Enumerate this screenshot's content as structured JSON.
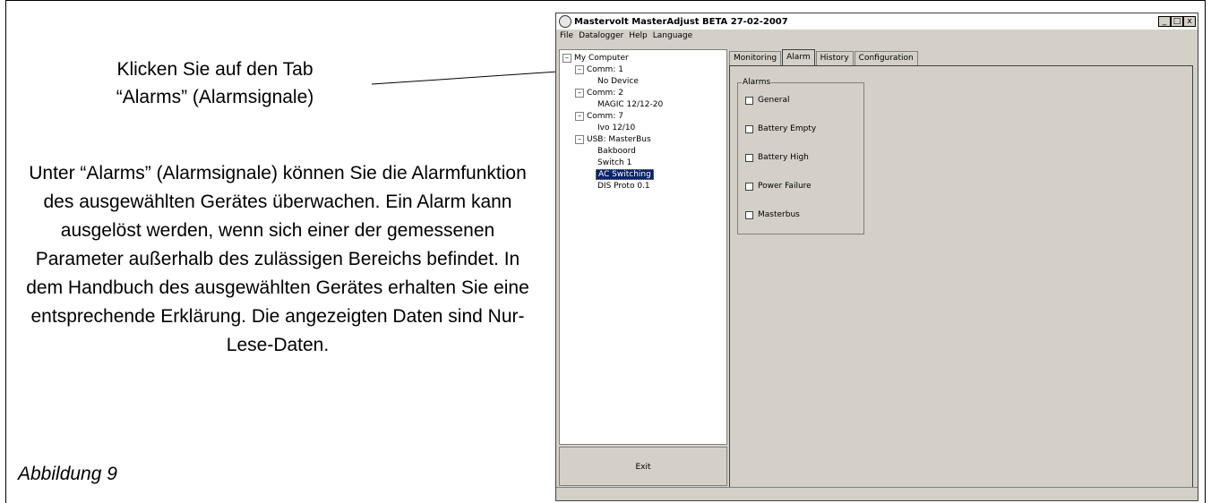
{
  "doc": {
    "callout_title_line1": "Klicken Sie auf den Tab",
    "callout_title_line2": "“Alarms” (Alarmsignale)",
    "description": "Unter “Alarms” (Alarmsignale) können Sie die Alarmfunktion des ausgewählten Gerätes überwachen. Ein Alarm kann ausgelöst werden, wenn sich einer der gemessenen Parameter außerhalb des zulässigen Bereichs befindet. In dem Handbuch des ausgewählten Gerätes erhalten Sie eine entsprechende Erklärung. Die angezeigten Daten sind Nur-Lese-Daten.",
    "caption": "Abbildung 9"
  },
  "window": {
    "title": "Mastervolt MasterAdjust BETA 27-02-2007",
    "menu": [
      "File",
      "Datalogger",
      "Help",
      "Language"
    ],
    "controls": [
      "_",
      "□",
      "x"
    ]
  },
  "tree": {
    "root": "My Computer",
    "comm1": "Comm: 1",
    "comm1_dev": "No Device",
    "comm2": "Comm: 2",
    "comm2_dev": "MAGIC 12/12-20",
    "comm7": "Comm: 7",
    "comm7_dev": "Ivo 12/10",
    "usb": "USB: MasterBus",
    "usb_dev1": "Bakboord",
    "usb_dev2": "Switch 1",
    "usb_dev3": "AC Switching",
    "usb_dev4": "DIS Proto 0.1",
    "expander": "–"
  },
  "exit_label": "Exit",
  "tabs": [
    "Monitoring",
    "Alarm",
    "History",
    "Configuration"
  ],
  "alarms": {
    "group_label": "Alarms",
    "items": [
      "General",
      "Battery Empty",
      "Battery High",
      "Power Failure",
      "Masterbus"
    ]
  }
}
